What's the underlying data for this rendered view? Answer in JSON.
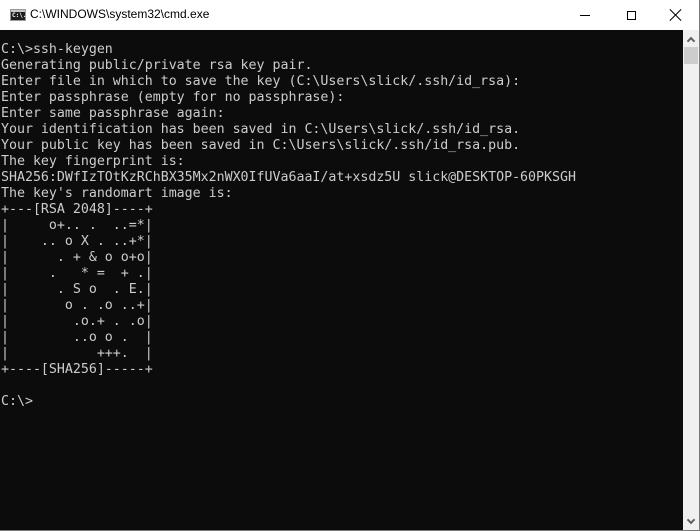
{
  "window": {
    "title": "C:\\WINDOWS\\system32\\cmd.exe",
    "icon": "cmd-icon",
    "icon_glyph": "C:\\.",
    "buttons": {
      "minimize": "minimize-icon",
      "maximize": "maximize-icon",
      "close": "close-icon"
    }
  },
  "console": {
    "background": "#0c0c0c",
    "foreground": "#cccccc",
    "lines": [
      "C:\\>ssh-keygen",
      "Generating public/private rsa key pair.",
      "Enter file in which to save the key (C:\\Users\\slick/.ssh/id_rsa):",
      "Enter passphrase (empty for no passphrase):",
      "Enter same passphrase again:",
      "Your identification has been saved in C:\\Users\\slick/.ssh/id_rsa.",
      "Your public key has been saved in C:\\Users\\slick/.ssh/id_rsa.pub.",
      "The key fingerprint is:",
      "SHA256:DWfIzTOtKzRChBX35Mx2nWX0IfUVa6aaI/at+xsdz5U slick@DESKTOP-60PKSGH",
      "The key's randomart image is:",
      "+---[RSA 2048]----+",
      "|     o+.. .  ..=*|",
      "|    .. o X . ..+*|",
      "|      . + & o o+o|",
      "|     .   * =  + .|",
      "|      . S o  . E.|",
      "|       o . .o ..+|",
      "|        .o.+ . .o|",
      "|        ..o o .  |",
      "|           +++.  |",
      "+----[SHA256]-----+",
      "",
      "C:\\>"
    ]
  },
  "scrollbar": {
    "up_icon": "chevron-up-icon",
    "down_icon": "chevron-down-icon"
  }
}
